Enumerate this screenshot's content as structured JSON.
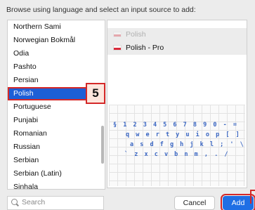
{
  "instruction": "Browse using language and select an input source to add:",
  "languages": [
    {
      "label": "Northern Sami"
    },
    {
      "label": "Norwegian Bokmål"
    },
    {
      "label": "Odia"
    },
    {
      "label": "Pashto"
    },
    {
      "label": "Persian"
    },
    {
      "label": "Polish",
      "selected": true
    },
    {
      "label": "Portuguese"
    },
    {
      "label": "Punjabi"
    },
    {
      "label": "Romanian"
    },
    {
      "label": "Russian"
    },
    {
      "label": "Serbian"
    },
    {
      "label": "Serbian (Latin)"
    },
    {
      "label": "Sinhala"
    }
  ],
  "step_badge": "5",
  "sources": {
    "header": "Polish",
    "selected": "Polish - Pro"
  },
  "keyboard_rows": [
    "§ 1 2 3 4 5 6 7 8 9 0 - =",
    "q w e r t y u i o p [ ]",
    "a s d f g h j k l ; ' \\",
    "` z x c v b n m , . /"
  ],
  "search": {
    "placeholder": "Search"
  },
  "buttons": {
    "cancel": "Cancel",
    "add": "Add"
  },
  "colors": {
    "selection": "#1d5fd6",
    "highlight": "#d42828",
    "primary_button": "#1f6fe5"
  }
}
